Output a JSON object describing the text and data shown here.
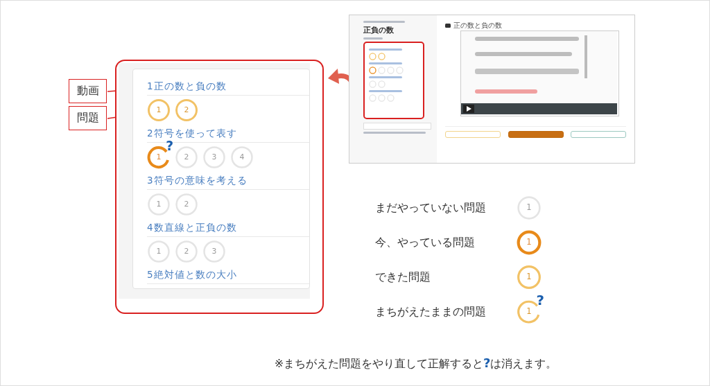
{
  "labels": [
    {
      "text": "動画"
    },
    {
      "text": "問題"
    }
  ],
  "units": [
    {
      "title": "1正の数と負の数",
      "problems": [
        {
          "number": "1",
          "done": true,
          "current": false,
          "wrong": false
        },
        {
          "number": "2",
          "done": true,
          "current": false,
          "wrong": false
        }
      ]
    },
    {
      "title": "2符号を使って表す",
      "problems": [
        {
          "number": "1",
          "done": false,
          "current": true,
          "wrong": true
        },
        {
          "number": "2",
          "done": false,
          "current": false,
          "wrong": false
        },
        {
          "number": "3",
          "done": false,
          "current": false,
          "wrong": false
        },
        {
          "number": "4",
          "done": false,
          "current": false,
          "wrong": false
        }
      ]
    },
    {
      "title": "3符号の意味を考える",
      "problems": [
        {
          "number": "1",
          "done": false,
          "current": false,
          "wrong": false
        },
        {
          "number": "2",
          "done": false,
          "current": false,
          "wrong": false
        }
      ]
    },
    {
      "title": "4数直線と正負の数",
      "problems": [
        {
          "number": "1",
          "done": false,
          "current": false,
          "wrong": false
        },
        {
          "number": "2",
          "done": false,
          "current": false,
          "wrong": false
        },
        {
          "number": "3",
          "done": false,
          "current": false,
          "wrong": false
        }
      ]
    },
    {
      "title": "5絶対値と数の大小"
    }
  ],
  "thumbnail": {
    "title": "正負の数",
    "video_title": "正の数と負の数"
  },
  "legend": [
    {
      "text": "まだやっていない問題",
      "number": "1",
      "done": false,
      "current": false,
      "wrong": false
    },
    {
      "text": "今、やっている問題",
      "number": "1",
      "done": false,
      "current": true,
      "wrong": false
    },
    {
      "text": "できた問題",
      "number": "1",
      "done": true,
      "current": false,
      "wrong": false
    },
    {
      "text": "まちがえたままの問題",
      "number": "1",
      "done": true,
      "current": false,
      "wrong": true
    }
  ],
  "note": {
    "before": "※まちがえた問題をやり直して正解すると",
    "mark": "?",
    "after": "は消えます。"
  }
}
